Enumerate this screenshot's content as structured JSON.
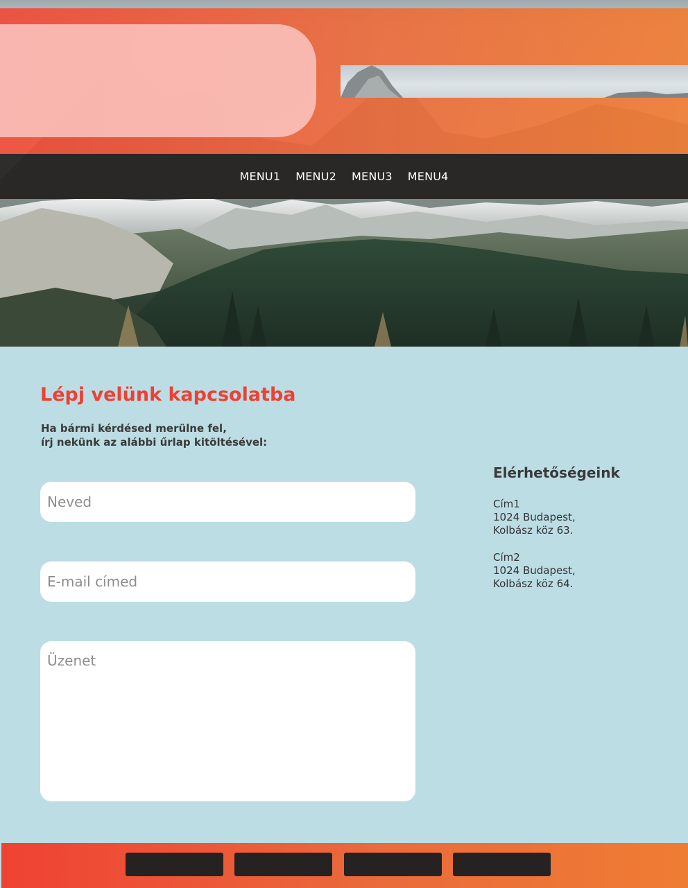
{
  "nav": {
    "items": [
      {
        "label": "MENU1"
      },
      {
        "label": "MENU2"
      },
      {
        "label": "MENU3"
      },
      {
        "label": "MENU4"
      }
    ]
  },
  "contact": {
    "title": "Lépj velünk kapcsolatba",
    "intro_line1": "Ha bármi kérdésed merülne fel,",
    "intro_line2": "írj nekünk az alábbi űrlap kitöltésével:",
    "form": {
      "name_placeholder": "Neved",
      "email_placeholder": "E-mail címed",
      "message_placeholder": "Üzenet"
    },
    "info_heading": "Elérhetőségeink",
    "addresses": [
      {
        "label": "Cím1",
        "line1": "1024 Budapest,",
        "line2": "Kolbász köz 63."
      },
      {
        "label": "Cím2",
        "line1": "1024 Budapest,",
        "line2": "Kolbász köz 64."
      }
    ]
  },
  "colors": {
    "accent_red": "#ec4135",
    "accent_orange": "#ef7c33",
    "background": "#bcdde4",
    "nav_bg": "#262222"
  },
  "footer": {
    "buttons": 4
  }
}
